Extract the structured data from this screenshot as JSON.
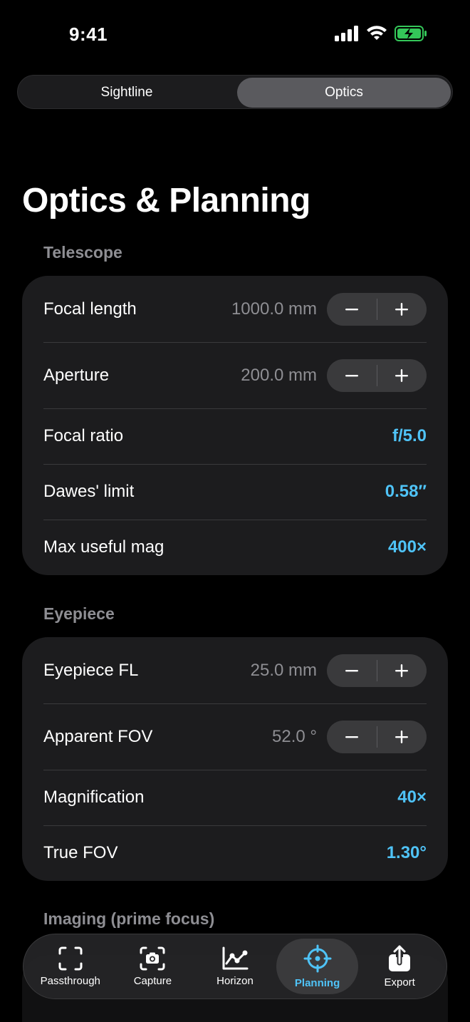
{
  "status": {
    "time": "9:41"
  },
  "segments": [
    {
      "label": "Sightline",
      "selected": false
    },
    {
      "label": "Optics",
      "selected": true
    }
  ],
  "page_title": "Optics & Planning",
  "telescope": {
    "header": "Telescope",
    "focal_length": {
      "label": "Focal length",
      "value": "1000.0 mm"
    },
    "aperture": {
      "label": "Aperture",
      "value": "200.0 mm"
    },
    "focal_ratio": {
      "label": "Focal ratio",
      "value": "f/5.0"
    },
    "dawes_limit": {
      "label": "Dawes' limit",
      "value": "0.58″"
    },
    "max_mag": {
      "label": "Max useful mag",
      "value": "400×"
    }
  },
  "eyepiece": {
    "header": "Eyepiece",
    "eyepiece_fl": {
      "label": "Eyepiece FL",
      "value": "25.0 mm"
    },
    "apparent_fov": {
      "label": "Apparent FOV",
      "value": "52.0 °"
    },
    "magnification": {
      "label": "Magnification",
      "value": "40×"
    },
    "true_fov": {
      "label": "True FOV",
      "value": "1.30°"
    }
  },
  "imaging": {
    "header": "Imaging (prime focus)"
  },
  "stepper": {
    "minus": "−",
    "plus": "+"
  },
  "tabs": [
    {
      "label": "Passthrough",
      "icon": "passthrough-icon",
      "active": false
    },
    {
      "label": "Capture",
      "icon": "camera-icon",
      "active": false
    },
    {
      "label": "Horizon",
      "icon": "chart-icon",
      "active": false
    },
    {
      "label": "Planning",
      "icon": "crosshair-icon",
      "active": true
    },
    {
      "label": "Export",
      "icon": "share-icon",
      "active": false
    }
  ],
  "colors": {
    "accent": "#4fc3f7",
    "battery": "#34c759",
    "card": "#1c1c1e",
    "secondary_text": "#8e8e93"
  }
}
